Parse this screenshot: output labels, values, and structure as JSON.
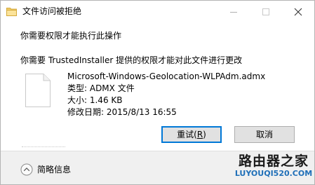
{
  "window": {
    "title": "文件访问被拒绝",
    "title_icon": "folder-icon",
    "controls": {
      "minimize_icon": "minimize-icon",
      "maximize_icon": "maximize-icon",
      "close_icon": "close-icon"
    }
  },
  "dialog": {
    "heading": "你需要权限才能执行此操作",
    "message": "你需要 TrustedInstaller 提供的权限才能对此文件进行更改",
    "file": {
      "icon": "file-icon",
      "name": "Microsoft-Windows-Geolocation-WLPAdm.admx",
      "type_line": "类型: ADMX 文件",
      "size_line": "大小: 1.46 KB",
      "modified_line": "修改日期: 2015/8/13 16:55"
    },
    "buttons": {
      "retry_text": "重试(",
      "retry_key": "R",
      "retry_end": ")",
      "cancel": "取消"
    }
  },
  "footer": {
    "details_label": "简略信息",
    "details_icon": "chevron-up-icon"
  },
  "watermark": {
    "main": "路由器之家",
    "url": "LUYOUQI520.COM"
  },
  "colors": {
    "accent": "#0078d7",
    "button_bg": "#e1e1e1",
    "footer_bg": "#f0f0f0",
    "watermark_url": "#1f6fb8"
  }
}
